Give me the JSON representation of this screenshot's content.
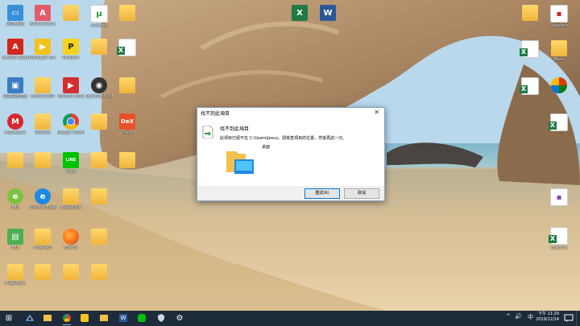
{
  "desktop": {
    "icons_col1": [
      {
        "label": "遠端-桌面",
        "kind": "monitor",
        "color": "#3a8fd9"
      },
      {
        "label": "Acrobat Reader DC",
        "kind": "app",
        "color": "#d4271b"
      },
      {
        "label": "遠端桌面連線",
        "kind": "app",
        "color": "#3a7dc0"
      },
      {
        "label": "MEGAsync",
        "kind": "app",
        "color": "#d9272e"
      },
      {
        "label": "",
        "kind": "folder",
        "color": "#f0b43a"
      },
      {
        "label": "Ello",
        "kind": "app",
        "color": "#7cc242"
      },
      {
        "label": "Ello",
        "kind": "app",
        "color": "#4caf50"
      },
      {
        "label": "MegaSync",
        "kind": "folder",
        "color": "#f0b43a"
      }
    ],
    "icons_col2": [
      {
        "label": "ActiveCleans...",
        "kind": "app",
        "color": "#e35b6b"
      },
      {
        "label": "PotPlayer 64 bit",
        "kind": "app",
        "color": "#f3c21b"
      },
      {
        "label": "foobar2000",
        "kind": "folder",
        "color": "#f0b43a"
      },
      {
        "label": "WinRAR",
        "kind": "folder",
        "color": "#f0b43a"
      },
      {
        "label": "",
        "kind": "folder",
        "color": "#f0b43a"
      },
      {
        "label": "Internet Explorer",
        "kind": "app",
        "color": "#1e88e5"
      },
      {
        "label": "FreeCAD",
        "kind": "folder",
        "color": "#f0b43a"
      },
      {
        "label": "",
        "kind": "folder",
        "color": "#f0b43a"
      }
    ],
    "icons_col3": [
      {
        "label": "",
        "kind": "folder",
        "color": "#f0b43a"
      },
      {
        "label": "PCManX",
        "kind": "app",
        "color": "#f6d21c"
      },
      {
        "label": "YouTube Downloader",
        "kind": "app",
        "color": "#d32f2f"
      },
      {
        "label": "Google Chrome",
        "kind": "app",
        "color": "#e0e0e0"
      },
      {
        "label": "LINE",
        "kind": "app",
        "color": "#00c300"
      },
      {
        "label": "MagicDisc",
        "kind": "folder",
        "color": "#f0b43a"
      },
      {
        "label": "Firefox",
        "kind": "app",
        "color": "#ff7a1a"
      },
      {
        "label": "",
        "kind": "folder",
        "color": "#f0b43a"
      }
    ],
    "icons_col4": [
      {
        "label": "uTorrent",
        "kind": "app",
        "color": "#ffffff"
      },
      {
        "label": "",
        "kind": "folder",
        "color": "#f0b43a"
      },
      {
        "label": "OpenShot Video Editor",
        "kind": "app",
        "color": "#333333"
      },
      {
        "label": "",
        "kind": "folder",
        "color": "#f0b43a"
      },
      {
        "label": "",
        "kind": "folder",
        "color": "#f0b43a"
      },
      {
        "label": "",
        "kind": "folder",
        "color": "#f0b43a"
      },
      {
        "label": "",
        "kind": "folder",
        "color": "#f0b43a"
      },
      {
        "label": "",
        "kind": "folder",
        "color": "#f0b43a"
      }
    ],
    "icons_col5": [
      {
        "label": "",
        "kind": "folder",
        "color": "#f0b43a"
      },
      {
        "label": "",
        "kind": "xls",
        "color": "#1f7a44"
      },
      {
        "label": "",
        "kind": "folder",
        "color": "#f0b43a"
      },
      {
        "label": "DeX",
        "kind": "app",
        "color": "#e8502a"
      },
      {
        "label": "",
        "kind": "folder",
        "color": "#f0b43a"
      }
    ],
    "icons_top_middle": [
      {
        "label": "",
        "kind": "xls",
        "color": "#1f7a44"
      },
      {
        "label": "",
        "kind": "word",
        "color": "#2b5797"
      }
    ],
    "icons_right_a": [
      {
        "label": "",
        "kind": "folder",
        "color": "#f0b43a"
      },
      {
        "label": "",
        "kind": "xls",
        "color": "#1f7a44"
      },
      {
        "label": "",
        "kind": "xls",
        "color": "#1f7a44"
      }
    ],
    "icons_right_b": [
      {
        "label": "Laserlens",
        "kind": "doc",
        "color": "#c62828"
      },
      {
        "label": "Mialo",
        "kind": "folder",
        "color": "#f0b43a"
      },
      {
        "label": "",
        "kind": "app",
        "color": "#d83b01"
      },
      {
        "label": "",
        "kind": "xls",
        "color": "#1f7a44"
      },
      {
        "label": "",
        "kind": "doc",
        "color": "#8e44ad"
      },
      {
        "label": "practice",
        "kind": "xls",
        "color": "#1f7a44"
      }
    ]
  },
  "dialog": {
    "title": "找不到此項目",
    "close_glyph": "✕",
    "heading": "找不到此項目",
    "message": "此項目已經不在 C:\\Users\\Jesus。請檢查項目的位置，然後再試一次。",
    "location": "桌面",
    "retry_label": "重試(R)",
    "cancel_label": "取消"
  },
  "taskbar": {
    "start_glyph": "⊞",
    "time": "下午 11:20",
    "date": "2019/12/14",
    "tray_icons": [
      "^",
      "🔊",
      "中"
    ]
  },
  "colors": {
    "accent": "#0078d7",
    "taskbar": "#1e2b3b"
  }
}
